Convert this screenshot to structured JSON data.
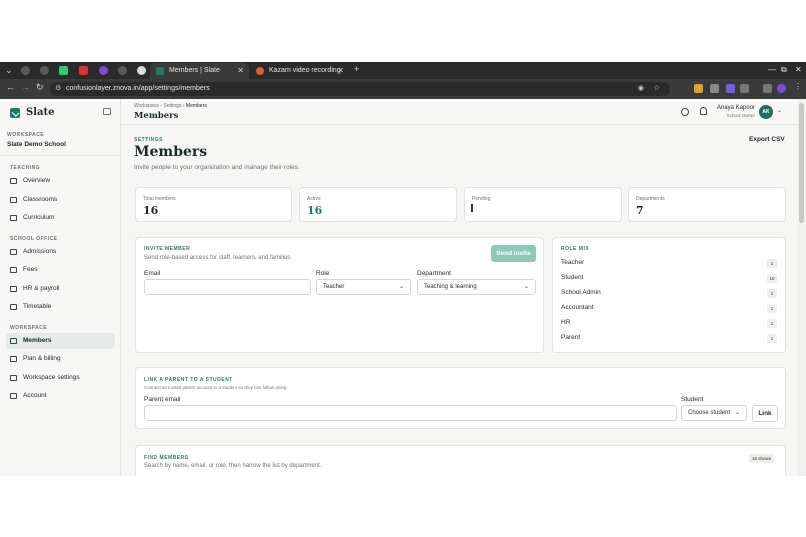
{
  "browser": {
    "tabs": [
      {
        "label": "Members | Slate",
        "active": true
      },
      {
        "label": "Kazam video recording",
        "active": false
      }
    ],
    "url": "confusionlayer.znova.in/app/settings/members",
    "new_tab": "+"
  },
  "sidebar": {
    "app_name": "Slate",
    "workspace_label": "WORKSPACE",
    "workspace_name": "Slate Demo School",
    "sections": [
      {
        "title": "TEACHING",
        "items": [
          "Overview",
          "Classrooms",
          "Curriculum"
        ]
      },
      {
        "title": "SCHOOL OFFICE",
        "items": [
          "Admissions",
          "Fees",
          "HR & payroll",
          "Timetable"
        ]
      },
      {
        "title": "WORKSPACE",
        "items": [
          "Members",
          "Plan & billing",
          "Workspace settings",
          "Account"
        ]
      }
    ],
    "active_item": "Members"
  },
  "topbar": {
    "breadcrumb": [
      "Workspace",
      "Settings",
      "Members"
    ],
    "title": "Members",
    "user_name": "Anaya Kapoor",
    "user_role": "School Owner",
    "avatar_initials": "AK"
  },
  "page": {
    "eyebrow": "SETTINGS",
    "title": "Members",
    "subtitle": "Invite people to your organization and manage their roles.",
    "export_label": "Export CSV"
  },
  "stats": [
    {
      "label": "Total members",
      "value": "16"
    },
    {
      "label": "Active",
      "value": "16"
    },
    {
      "label": "Pending",
      "value": "1"
    },
    {
      "label": "Departments",
      "value": "7"
    }
  ],
  "invite": {
    "eyebrow": "INVITE MEMBER",
    "subtitle": "Send role-based access for staff, learners, and families.",
    "button": "Send invite",
    "email_label": "Email",
    "email_value": "",
    "role_label": "Role",
    "role_value": "Teacher",
    "department_label": "Department",
    "department_value": "Teaching & learning"
  },
  "role_mix": {
    "eyebrow": "ROLE MIX",
    "roles": [
      {
        "name": "Teacher",
        "count": "1"
      },
      {
        "name": "Student",
        "count": "10"
      },
      {
        "name": "School Admin",
        "count": "1"
      },
      {
        "name": "Accountant",
        "count": "1"
      },
      {
        "name": "HR",
        "count": "1"
      },
      {
        "name": "Parent",
        "count": "1"
      }
    ]
  },
  "link_parent": {
    "eyebrow": "LINK A PARENT TO A STUDENT",
    "subtitle": "Connect an invited parent account to a student so they can follow along.",
    "parent_email_label": "Parent email",
    "parent_email_value": "",
    "student_label": "Student",
    "student_value": "Choose student",
    "button": "Link"
  },
  "find": {
    "eyebrow": "FIND MEMBERS",
    "subtitle": "Search by name, email, or role, then narrow the list by department.",
    "shown_badge": "16 shown"
  },
  "colors": {
    "accent": "#1f7a6a",
    "primary_button": "#8fc7b8",
    "chrome": "#2b2b2b"
  }
}
